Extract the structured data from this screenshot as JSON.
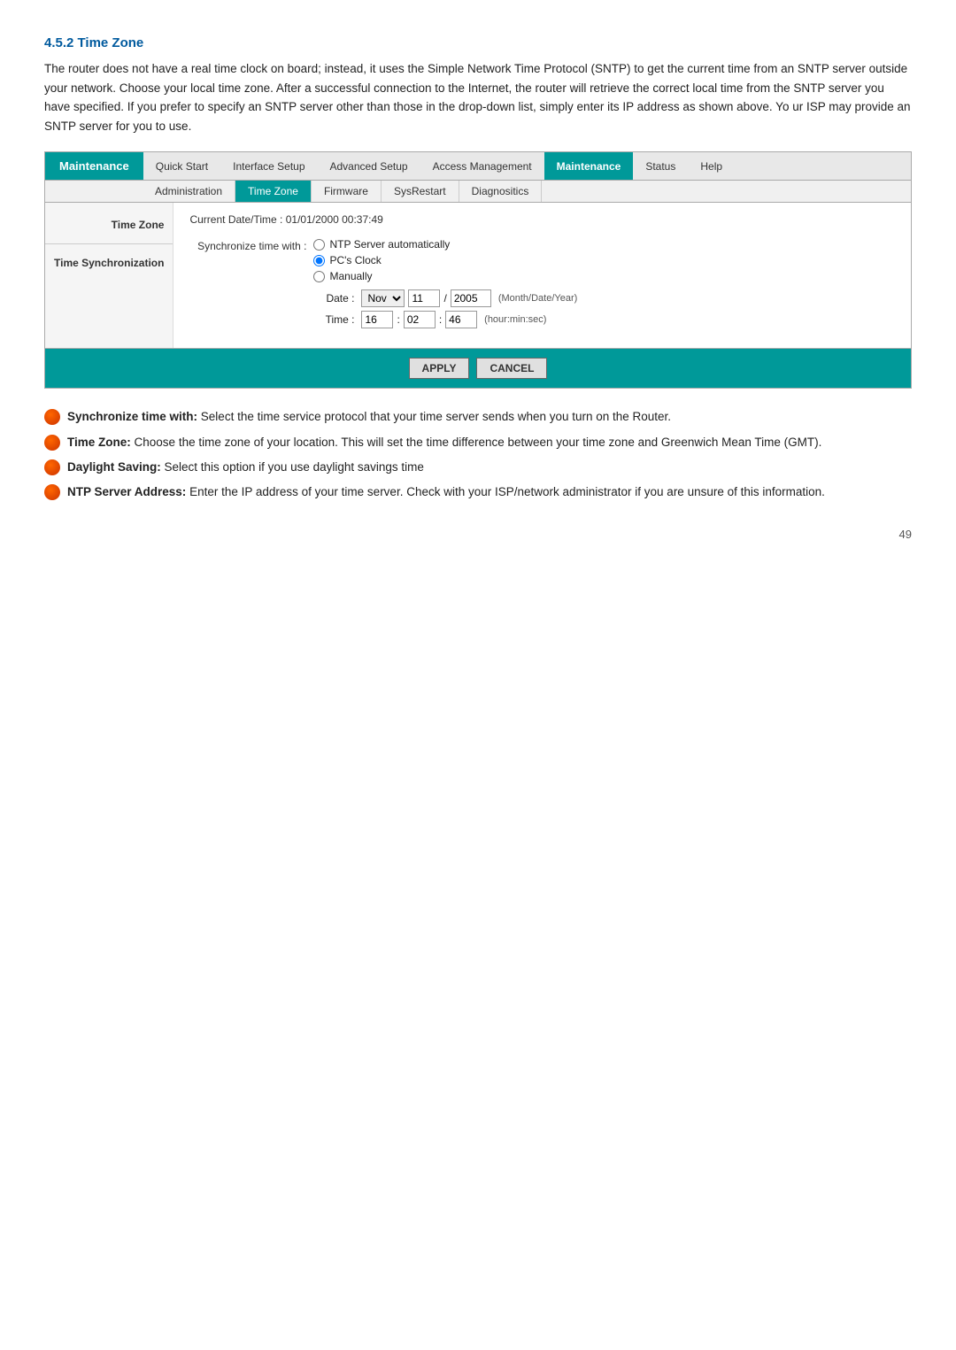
{
  "section": {
    "title": "4.5.2 Time Zone",
    "description": "The router does not have a real time clock on board; instead, it uses the Simple Network Time Protocol (SNTP) to get the current time from an SNTP server outside your network. Choose your local time zone. After a successful connection to the Internet, the router will retrieve the correct local time from the SNTP server you have specified. If you prefer to specify an SNTP server other than those in the drop-down list, simply enter its IP address as shown above. Yo ur ISP may provide an SNTP server for you to use."
  },
  "topnav": {
    "left_label": "Maintenance",
    "items": [
      {
        "label": "Quick Start",
        "active": false
      },
      {
        "label": "Interface Setup",
        "active": false
      },
      {
        "label": "Advanced Setup",
        "active": false
      },
      {
        "label": "Access Management",
        "active": false
      },
      {
        "label": "Maintenance",
        "active": true
      },
      {
        "label": "Status",
        "active": false
      },
      {
        "label": "Help",
        "active": false
      }
    ]
  },
  "subnav": {
    "items": [
      {
        "label": "Administration",
        "active": false
      },
      {
        "label": "Time Zone",
        "active": true
      },
      {
        "label": "Firmware",
        "active": false
      },
      {
        "label": "SysRestart",
        "active": false
      },
      {
        "label": "Diagnositics",
        "active": false
      }
    ]
  },
  "sidebar": {
    "items": [
      {
        "label": "Time Zone"
      },
      {
        "label": "Time Synchronization"
      }
    ]
  },
  "main": {
    "current_datetime_label": "Current Date/Time :",
    "current_datetime_value": "01/01/2000 00:37:49",
    "sync_label": "Synchronize time with :",
    "sync_options": [
      {
        "label": "NTP Server automatically",
        "value": "ntp",
        "checked": false
      },
      {
        "label": "PC's Clock",
        "value": "pc",
        "checked": true
      },
      {
        "label": "Manually",
        "value": "manual",
        "checked": false
      }
    ],
    "date_label": "Date :",
    "date_month": "Nov",
    "date_day": "11",
    "date_year": "2005",
    "date_hint": "(Month/Date/Year)",
    "time_label": "Time :",
    "time_hour": "16",
    "time_min": "02",
    "time_sec": "46",
    "time_hint": "(hour:min:sec)"
  },
  "buttons": {
    "apply": "APPLY",
    "cancel": "CANCEL"
  },
  "descriptions": [
    {
      "term": "Synchronize time with:",
      "text": "Select the time service protocol that your time server sends when you turn on the Router."
    },
    {
      "term": "Time Zone:",
      "text": "Choose the time zone of your location. This will set the time difference between your time zone and Greenwich Mean Time (GMT)."
    },
    {
      "term": "Daylight Saving:",
      "text": "Select this option if you use daylight savings time"
    },
    {
      "term": "NTP Server Address:",
      "text": "Enter the IP address of your time server. Check with your ISP/network administrator if you are unsure of this information."
    }
  ],
  "page_number": "49"
}
